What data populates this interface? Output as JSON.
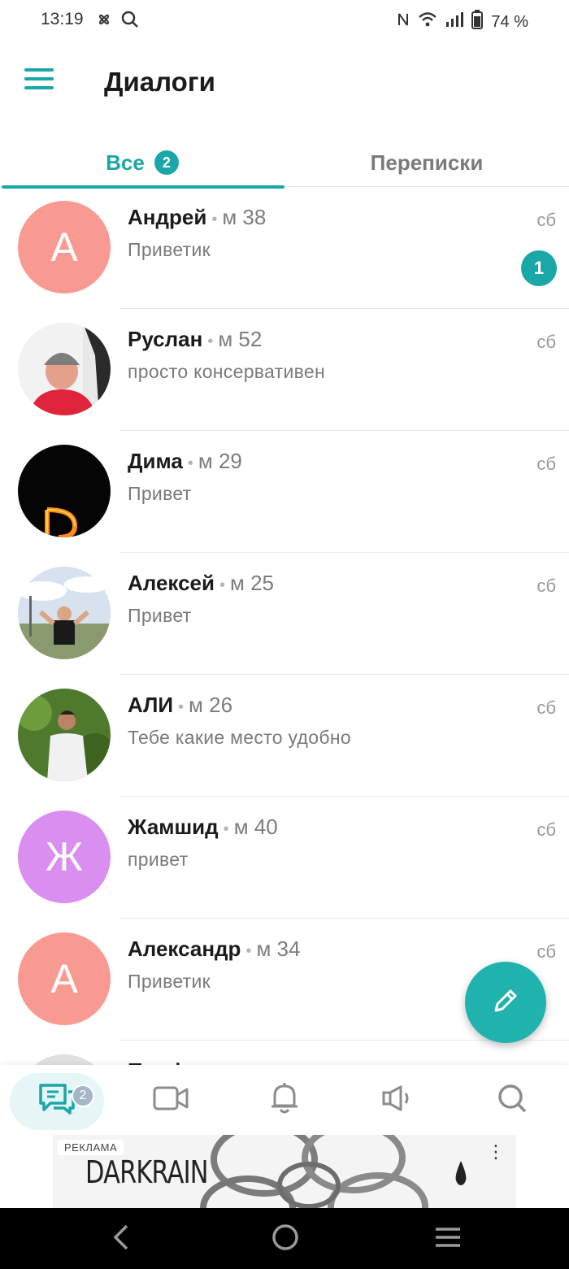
{
  "status_bar": {
    "time": "13:19",
    "battery": "74 %"
  },
  "header": {
    "title": "Диалоги"
  },
  "tabs": {
    "all": {
      "label": "Все",
      "badge": "2"
    },
    "chats": {
      "label": "Переписки"
    }
  },
  "dialogs": [
    {
      "name": "Андрей",
      "meta": "м 38",
      "preview": "Приветик",
      "date": "сб",
      "unread": "1",
      "avatar": {
        "type": "letter",
        "letter": "А",
        "color": "#f99a92"
      }
    },
    {
      "name": "Руслан",
      "meta": "м 52",
      "preview": "просто консервативен",
      "date": "сб",
      "avatar": {
        "type": "photo"
      }
    },
    {
      "name": "Дима",
      "meta": "м 29",
      "preview": "Привет",
      "date": "сб",
      "avatar": {
        "type": "photo"
      }
    },
    {
      "name": "Алексей",
      "meta": "м 25",
      "preview": "Привет",
      "date": "сб",
      "avatar": {
        "type": "photo"
      }
    },
    {
      "name": "АЛИ",
      "meta": "м 26",
      "preview": "Тебе какие место удобно",
      "date": "сб",
      "avatar": {
        "type": "photo"
      }
    },
    {
      "name": "Жамшид",
      "meta": "м 40",
      "preview": "привет",
      "date": "сб",
      "avatar": {
        "type": "letter",
        "letter": "Ж",
        "color": "#d98ef0"
      }
    },
    {
      "name": "Александр",
      "meta": "м 34",
      "preview": "Приветик",
      "date": "сб",
      "avatar": {
        "type": "letter",
        "letter": "А",
        "color": "#f99a92"
      }
    },
    {
      "name": "Профиль удален"
    }
  ],
  "bottom_nav": {
    "items": [
      "dialogs-icon",
      "video-icon",
      "bell-icon",
      "speaker-icon",
      "search-icon"
    ],
    "dialogs_badge": "2"
  },
  "ad": {
    "label": "РЕКЛАМА",
    "brand": "DARKRAIN",
    "more": "⋮"
  },
  "colors": {
    "accent": "#1aa7a7",
    "fab": "#20b2ad",
    "avatar_pink": "#f99a92",
    "avatar_purple": "#d98ef0"
  }
}
